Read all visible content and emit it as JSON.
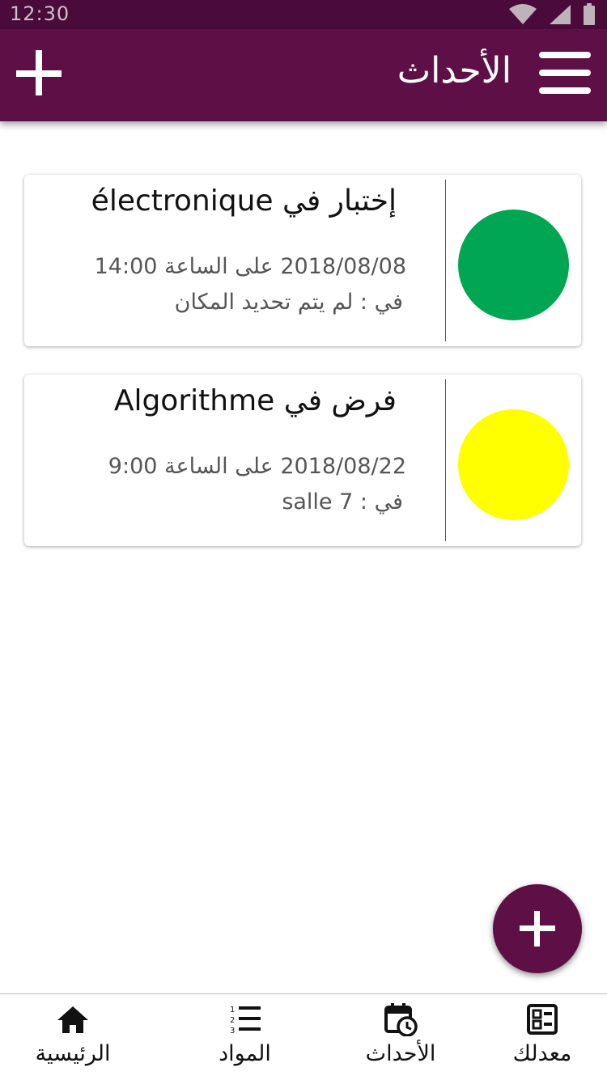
{
  "status_bar": {
    "time": "12:30"
  },
  "app_bar": {
    "title": "الأحداث"
  },
  "events": [
    {
      "title": "إختبار في électronique",
      "date_line": "2018/08/08 على الساعة 14:00",
      "place_line": "في : لم يتم تحديد المكان",
      "status_color": "#00a651"
    },
    {
      "title": "فرض في Algorithme",
      "date_line": "2018/08/22 على الساعة 9:00",
      "place_line": "في : salle 7",
      "status_color": "#ffff00"
    }
  ],
  "bottom_nav": {
    "items": [
      {
        "label": "الرئيسية",
        "icon": "home-icon"
      },
      {
        "label": "المواد",
        "icon": "numbered-list-icon"
      },
      {
        "label": "الأحداث",
        "icon": "calendar-clock-icon"
      },
      {
        "label": "معدلك",
        "icon": "grade-sheet-icon"
      }
    ]
  },
  "colors": {
    "primary": "#5e1046",
    "status_bar": "#4a0b3a"
  }
}
